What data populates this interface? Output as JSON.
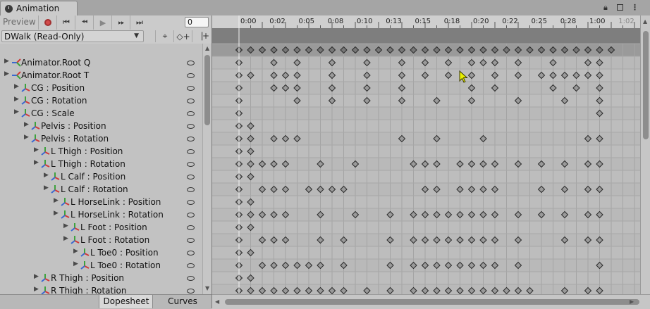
{
  "window": {
    "tab_label": "Animation"
  },
  "toolbar": {
    "preview_label": "Preview",
    "frame_value": "0"
  },
  "clip": {
    "selected_clip": "DWalk (Read-Only)"
  },
  "properties": [
    {
      "label": "Animator.Root Q",
      "indent": 0,
      "icon": "root-motion-icon"
    },
    {
      "label": "Animator.Root T",
      "indent": 0,
      "icon": "root-motion-icon"
    },
    {
      "label": "CG : Position",
      "indent": 1,
      "icon": "transform-icon"
    },
    {
      "label": "CG : Rotation",
      "indent": 1,
      "icon": "transform-icon"
    },
    {
      "label": "CG : Scale",
      "indent": 1,
      "icon": "transform-icon"
    },
    {
      "label": "Pelvis : Position",
      "indent": 2,
      "icon": "transform-icon"
    },
    {
      "label": "Pelvis : Rotation",
      "indent": 2,
      "icon": "transform-icon"
    },
    {
      "label": "L Thigh : Position",
      "indent": 3,
      "icon": "transform-icon"
    },
    {
      "label": "L Thigh : Rotation",
      "indent": 3,
      "icon": "transform-icon"
    },
    {
      "label": "L Calf : Position",
      "indent": 4,
      "icon": "transform-icon"
    },
    {
      "label": "L Calf : Rotation",
      "indent": 4,
      "icon": "transform-icon"
    },
    {
      "label": "L HorseLink : Position",
      "indent": 5,
      "icon": "transform-icon"
    },
    {
      "label": "L HorseLink : Rotation",
      "indent": 5,
      "icon": "transform-icon"
    },
    {
      "label": "L Foot : Position",
      "indent": 6,
      "icon": "transform-icon"
    },
    {
      "label": "L Foot : Rotation",
      "indent": 6,
      "icon": "transform-icon"
    },
    {
      "label": "L Toe0 : Position",
      "indent": 7,
      "icon": "transform-icon"
    },
    {
      "label": "L Toe0 : Rotation",
      "indent": 7,
      "icon": "transform-icon"
    },
    {
      "label": "R Thigh : Position",
      "indent": 3,
      "icon": "transform-icon"
    },
    {
      "label": "R Thigh : Rotation",
      "indent": 3,
      "icon": "transform-icon"
    }
  ],
  "timeline": {
    "labels": [
      "0:00",
      "0:02",
      "0:05",
      "0:08",
      "0:10",
      "0:13",
      "0:15",
      "0:18",
      "0:20",
      "0:22",
      "0:25",
      "0:28",
      "1:00",
      "1:02"
    ],
    "playhead_frame": 0,
    "keyframes": {
      "summary": [
        0,
        1,
        2,
        3,
        4,
        5,
        6,
        7,
        8,
        9,
        10,
        11,
        12,
        13,
        14,
        15,
        16,
        17,
        18,
        19,
        20,
        21,
        22,
        23,
        24,
        25,
        26,
        27,
        28,
        29,
        30,
        31,
        32
      ],
      "rows": [
        [
          0,
          3,
          5,
          8,
          11,
          14,
          16,
          18,
          20,
          21,
          22,
          24,
          27,
          30,
          31
        ],
        [
          0,
          1,
          3,
          4,
          5,
          8,
          11,
          14,
          16,
          18,
          20,
          22,
          24,
          26,
          27,
          28,
          29,
          30,
          31
        ],
        [
          0,
          3,
          4,
          5,
          8,
          11,
          14,
          20,
          22,
          27,
          29,
          31
        ],
        [
          0,
          5,
          8,
          11,
          14,
          17,
          20,
          24,
          28,
          31
        ],
        [
          0,
          31
        ],
        [
          0,
          1
        ],
        [
          0,
          1,
          3,
          4,
          5,
          14,
          17,
          21,
          30,
          31
        ],
        [
          0,
          1
        ],
        [
          0,
          1,
          2,
          3,
          4,
          7,
          10,
          15,
          16,
          17,
          19,
          20,
          21,
          22,
          24,
          26,
          28,
          30,
          31
        ],
        [
          0,
          1
        ],
        [
          0,
          2,
          3,
          4,
          6,
          7,
          8,
          9,
          16,
          17,
          19,
          20,
          21,
          22,
          26,
          28,
          30,
          31
        ],
        [
          0,
          1
        ],
        [
          0,
          1,
          2,
          3,
          4,
          7,
          10,
          13,
          15,
          16,
          17,
          18,
          19,
          20,
          21,
          22,
          24,
          26,
          28,
          30,
          31
        ],
        [
          0,
          1
        ],
        [
          0,
          2,
          3,
          4,
          7,
          9,
          13,
          15,
          16,
          17,
          18,
          19,
          20,
          21,
          22,
          24,
          28,
          30,
          31
        ],
        [
          0,
          1
        ],
        [
          0,
          2,
          3,
          4,
          5,
          6,
          7,
          9,
          13,
          15,
          16,
          17,
          18,
          19,
          20,
          21,
          22,
          24,
          31
        ],
        [
          0,
          1
        ],
        [
          0,
          1,
          2,
          3,
          4,
          5,
          6,
          7,
          8,
          9,
          11,
          13,
          15,
          16,
          17,
          18,
          19,
          20,
          21,
          22,
          23,
          24,
          25,
          28,
          30,
          31
        ]
      ]
    }
  },
  "bottom_tabs": {
    "dopesheet": "Dopesheet",
    "curves": "Curves"
  },
  "colors": {
    "panel": "#c2c2c2",
    "track": "#b9b9b9",
    "summary": "#9a9a9a",
    "record": "#d24a4a",
    "grid": "#a4a4a4"
  }
}
